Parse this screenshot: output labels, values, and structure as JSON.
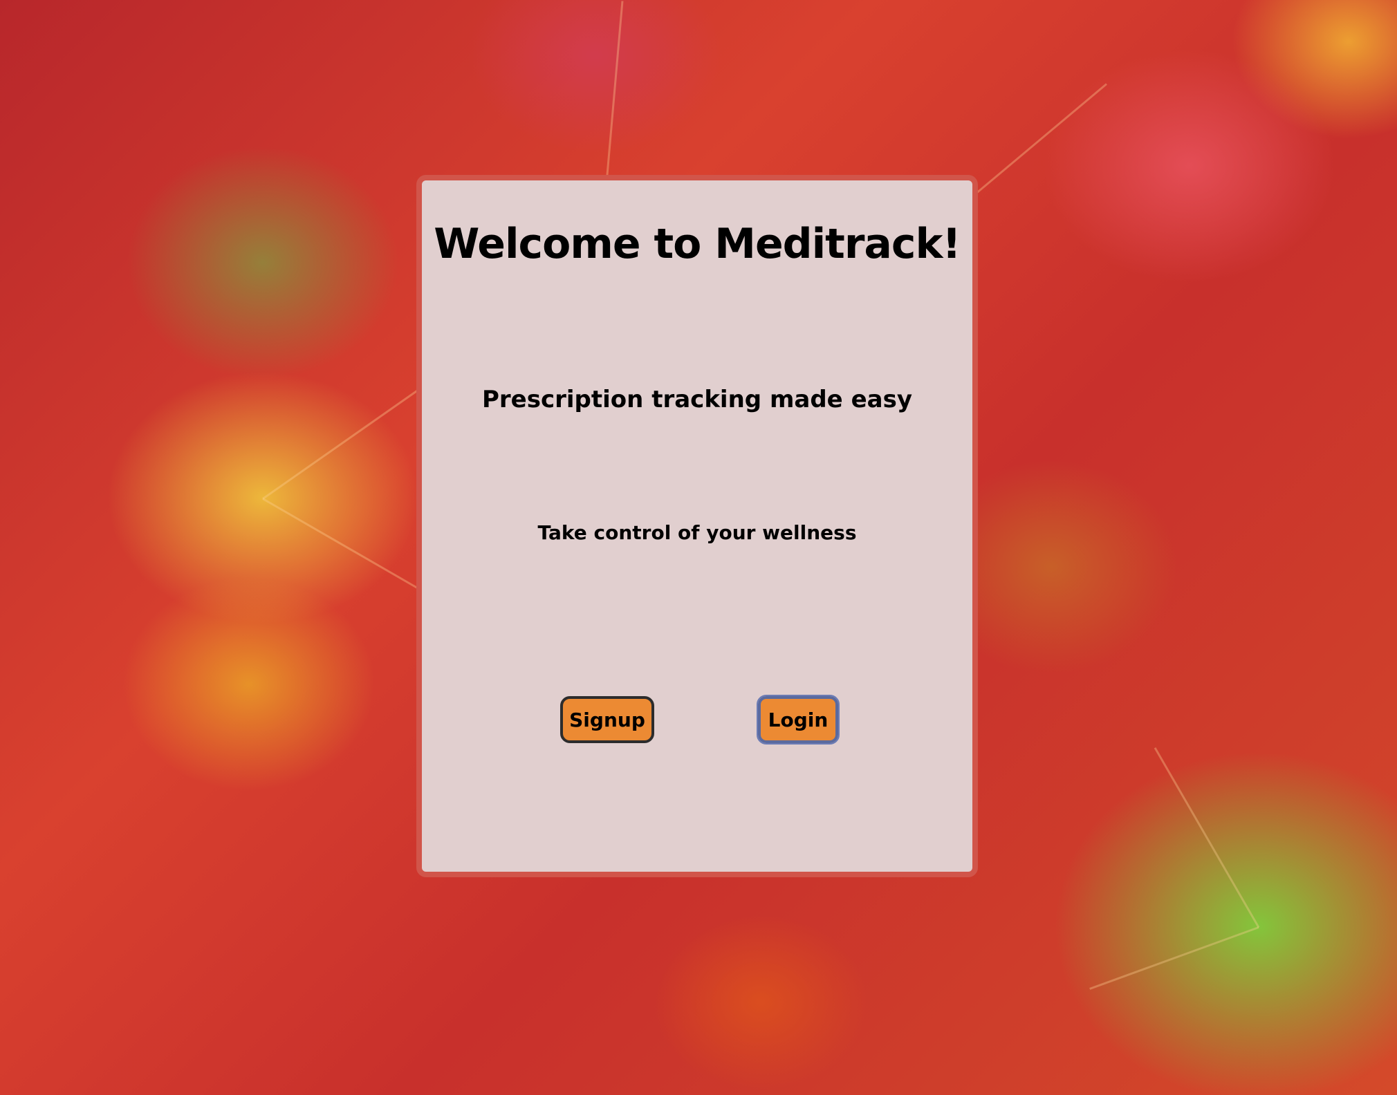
{
  "page": {
    "title": "Welcome to Meditrack!",
    "subtitle": "Prescription tracking made easy",
    "tagline": "Take control of your wellness"
  },
  "actions": {
    "signup_label": "Signup",
    "login_label": "Login"
  },
  "colors": {
    "card_background": "#e1cfcf",
    "card_border": "#d1554a",
    "button_background": "#ec8a33"
  }
}
